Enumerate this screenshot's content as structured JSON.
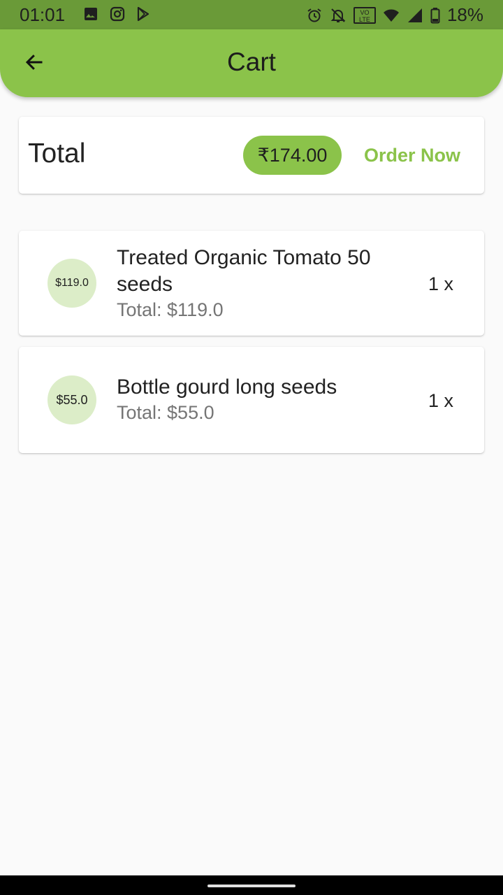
{
  "status_bar": {
    "time": "01:01",
    "battery": "18%",
    "left_icons": [
      "gallery-icon",
      "instagram-icon",
      "play-store-icon"
    ],
    "right_icons": [
      "alarm-icon",
      "notifications-off-icon",
      "volte-icon",
      "wifi-icon",
      "signal-icon",
      "battery-icon"
    ],
    "volte_text": "VO LTE"
  },
  "app_bar": {
    "title": "Cart",
    "back_icon": "arrow-back-icon"
  },
  "summary": {
    "label": "Total",
    "amount": "₹174.00",
    "order_button": "Order Now"
  },
  "items": [
    {
      "price_badge": "$119.0",
      "title": "Treated Organic Tomato 50 seeds",
      "subtotal": "Total: $119.0",
      "quantity": "1 x"
    },
    {
      "price_badge": "$55.0",
      "title": "Bottle gourd long seeds",
      "subtotal": "Total: $55.0",
      "quantity": "1 x"
    }
  ],
  "colors": {
    "primary": "#8bc34a",
    "status_bar": "#6a9a38",
    "avatar_bg": "#dcedc8",
    "background": "#fafafa"
  }
}
